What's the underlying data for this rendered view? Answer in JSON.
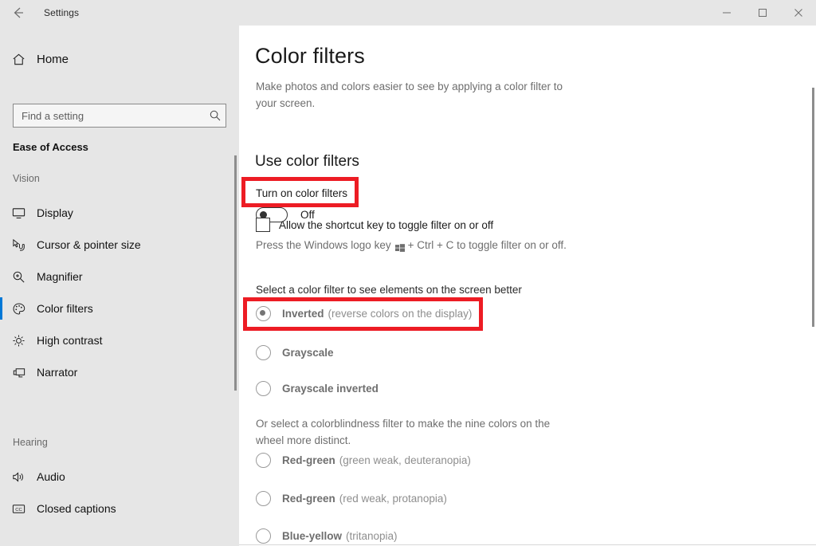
{
  "window": {
    "title": "Settings",
    "back_icon": "back-arrow-icon",
    "minimize_label": "Minimize",
    "maximize_label": "Maximize",
    "close_label": "Close"
  },
  "sidebar": {
    "home": {
      "label": "Home",
      "icon": "home-icon"
    },
    "search": {
      "placeholder": "Find a setting",
      "value": "",
      "icon": "search-icon"
    },
    "category": "Ease of Access",
    "groups": [
      {
        "label": "Vision",
        "items": [
          {
            "label": "Display",
            "icon": "monitor-icon",
            "selected": false
          },
          {
            "label": "Cursor & pointer size",
            "icon": "cursor-pointer-icon",
            "selected": false
          },
          {
            "label": "Magnifier",
            "icon": "magnifier-icon",
            "selected": false
          },
          {
            "label": "Color filters",
            "icon": "palette-icon",
            "selected": true
          },
          {
            "label": "High contrast",
            "icon": "brightness-icon",
            "selected": false
          },
          {
            "label": "Narrator",
            "icon": "narrator-icon",
            "selected": false
          }
        ]
      },
      {
        "label": "Hearing",
        "items": [
          {
            "label": "Audio",
            "icon": "speaker-icon",
            "selected": false
          },
          {
            "label": "Closed captions",
            "icon": "closed-captions-icon",
            "selected": false
          }
        ]
      }
    ]
  },
  "main": {
    "title": "Color filters",
    "description": "Make photos and colors easier to see by applying a color filter to your screen.",
    "section_heading": "Use color filters",
    "toggle": {
      "label": "Turn on color filters",
      "state": "Off",
      "checked": false
    },
    "shortcut_checkbox": {
      "label": "Allow the shortcut key to toggle filter on or off",
      "checked": false
    },
    "shortcut_hint_before": "Press the Windows logo key",
    "shortcut_hint_after": "+ Ctrl + C to toggle filter on or off.",
    "windows_key_icon": "windows-logo-icon",
    "filter_prompt": "Select a color filter to see elements on the screen better",
    "filter_options": [
      {
        "name": "Inverted",
        "detail": "(reverse colors on the display)",
        "selected": true
      },
      {
        "name": "Grayscale",
        "detail": "",
        "selected": false
      },
      {
        "name": "Grayscale inverted",
        "detail": "",
        "selected": false
      }
    ],
    "colorblind_prompt": "Or select a colorblindness filter to make the nine colors on the wheel more distinct.",
    "colorblind_options": [
      {
        "name": "Red-green",
        "detail": "(green weak, deuteranopia)",
        "selected": false
      },
      {
        "name": "Red-green",
        "detail": "(red weak, protanopia)",
        "selected": false
      },
      {
        "name": "Blue-yellow",
        "detail": "(tritanopia)",
        "selected": false
      }
    ]
  },
  "annotations": {
    "highlight_color": "#ed1c24",
    "boxes": [
      {
        "name": "toggle-highlight",
        "target": "Turn on color filters toggle"
      },
      {
        "name": "inverted-highlight",
        "target": "Inverted filter radio option"
      }
    ]
  },
  "theme": {
    "accent": "#0078d7",
    "sidebar_bg": "#e6e6e6",
    "content_bg": "#ffffff",
    "muted_text": "#6e6e6e"
  }
}
